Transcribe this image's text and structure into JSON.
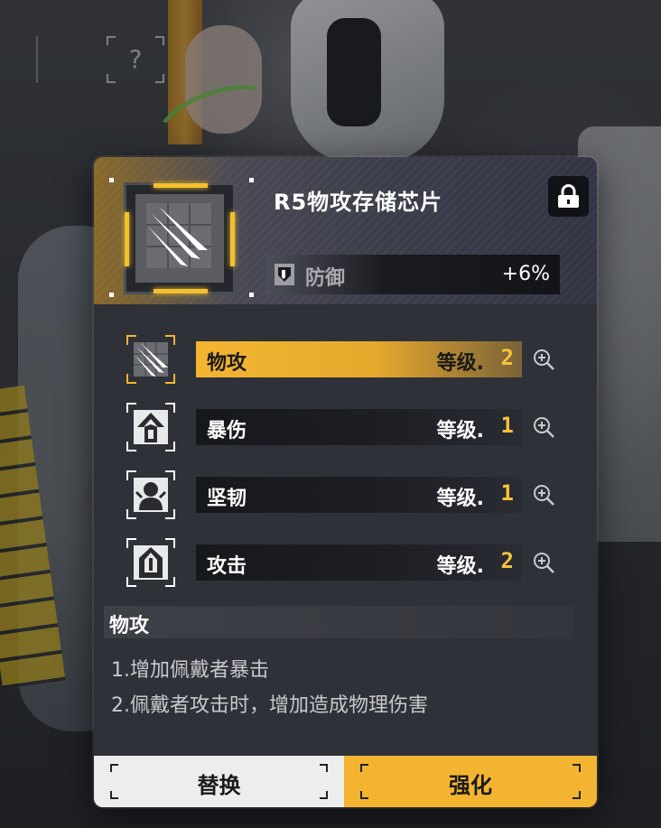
{
  "chip": {
    "title": "R5物攻存储芯片",
    "lock_icon": "lock-icon",
    "main_stat": {
      "icon": "shield-icon",
      "label": "防御",
      "value": "+6%"
    }
  },
  "sub_stats": [
    {
      "name": "物攻",
      "level_label": "等级.",
      "level": "2",
      "icon": "claw-icon",
      "selected": true
    },
    {
      "name": "暴伤",
      "level_label": "等级.",
      "level": "1",
      "icon": "crit-damage-icon",
      "selected": false
    },
    {
      "name": "坚韧",
      "level_label": "等级.",
      "level": "1",
      "icon": "toughness-icon",
      "selected": false
    },
    {
      "name": "攻击",
      "level_label": "等级.",
      "level": "2",
      "icon": "attack-icon",
      "selected": false
    }
  ],
  "description": {
    "title": "物攻",
    "lines": [
      "1.增加佩戴者暴击",
      "2.佩戴者攻击时，增加造成物理伤害"
    ]
  },
  "buttons": {
    "swap_label": "替换",
    "upgrade_label": "强化"
  },
  "background": {
    "unknown_slot_glyph": "?"
  },
  "colors": {
    "accent": "#f3b531",
    "panel": "#2f3138",
    "level_number": "#f6c23a"
  }
}
